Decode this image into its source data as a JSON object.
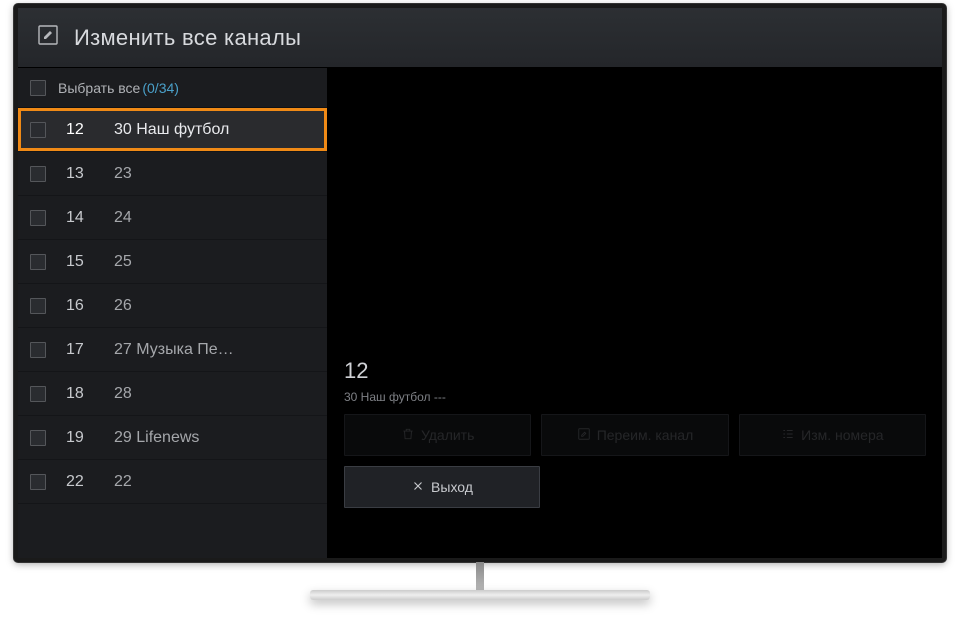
{
  "header": {
    "title": "Изменить все каналы"
  },
  "selectAll": {
    "label": "Выбрать все",
    "count": "(0/34)"
  },
  "channels": [
    {
      "num": "12",
      "name": "30 Наш футбол",
      "selected": true
    },
    {
      "num": "13",
      "name": "23",
      "selected": false
    },
    {
      "num": "14",
      "name": "24",
      "selected": false
    },
    {
      "num": "15",
      "name": "25",
      "selected": false
    },
    {
      "num": "16",
      "name": "26",
      "selected": false
    },
    {
      "num": "17",
      "name": "27 Музыка Пе…",
      "selected": false
    },
    {
      "num": "18",
      "name": "28",
      "selected": false
    },
    {
      "num": "19",
      "name": "29 Lifenews",
      "selected": false
    },
    {
      "num": "22",
      "name": "22",
      "selected": false
    }
  ],
  "preview": {
    "channelNumber": "12",
    "channelInfo": "30 Наш футбол ---"
  },
  "buttons": {
    "delete": "Удалить",
    "rename": "Переим. канал",
    "renumber": "Изм. номера",
    "exit": "Выход"
  }
}
